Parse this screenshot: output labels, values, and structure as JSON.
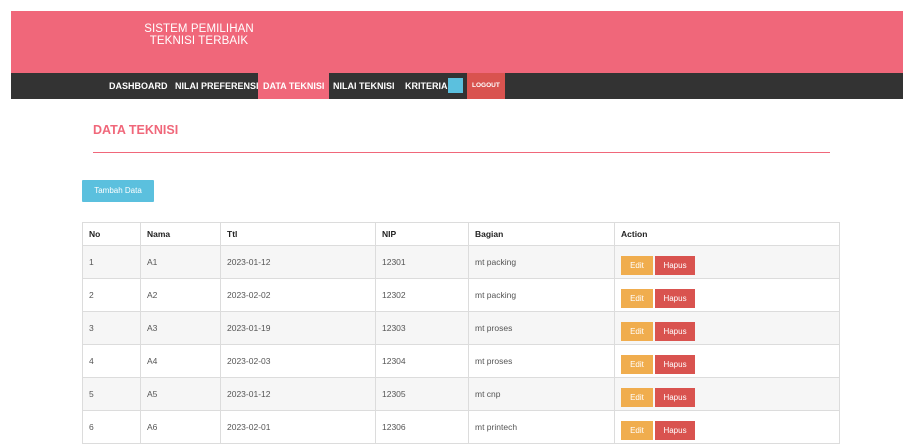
{
  "brand": {
    "line1": "SISTEM PEMILIHAN",
    "line2": "TEKNISI TERBAIK"
  },
  "nav": {
    "items": [
      "DASHBOARD",
      "NILAI PREFERENSI",
      "DATA TEKNISI",
      "NILAI TEKNISI",
      "KRITERIA"
    ],
    "active_index": 2,
    "logout": "LOGOUT"
  },
  "page": {
    "title": "DATA TEKNISI",
    "add_button": "Tambah Data"
  },
  "table": {
    "headers": [
      "No",
      "Nama",
      "Ttl",
      "NIP",
      "Bagian",
      "Action"
    ],
    "rows": [
      [
        "1",
        "A1",
        "2023-01-12",
        "12301",
        "mt packing"
      ],
      [
        "2",
        "A2",
        "2023-02-02",
        "12302",
        "mt packing"
      ],
      [
        "3",
        "A3",
        "2023-01-19",
        "12303",
        "mt proses"
      ],
      [
        "4",
        "A4",
        "2023-02-03",
        "12304",
        "mt proses"
      ],
      [
        "5",
        "A5",
        "2023-01-12",
        "12305",
        "mt cnp"
      ],
      [
        "6",
        "A6",
        "2023-02-01",
        "12306",
        "mt printech"
      ]
    ],
    "edit_label": "Edit",
    "delete_label": "Hapus"
  },
  "colors": {
    "primary": "#f0677a",
    "nav_bg": "#333333",
    "info": "#5bc0de",
    "warning": "#f0ad4e",
    "danger": "#d9534f"
  }
}
